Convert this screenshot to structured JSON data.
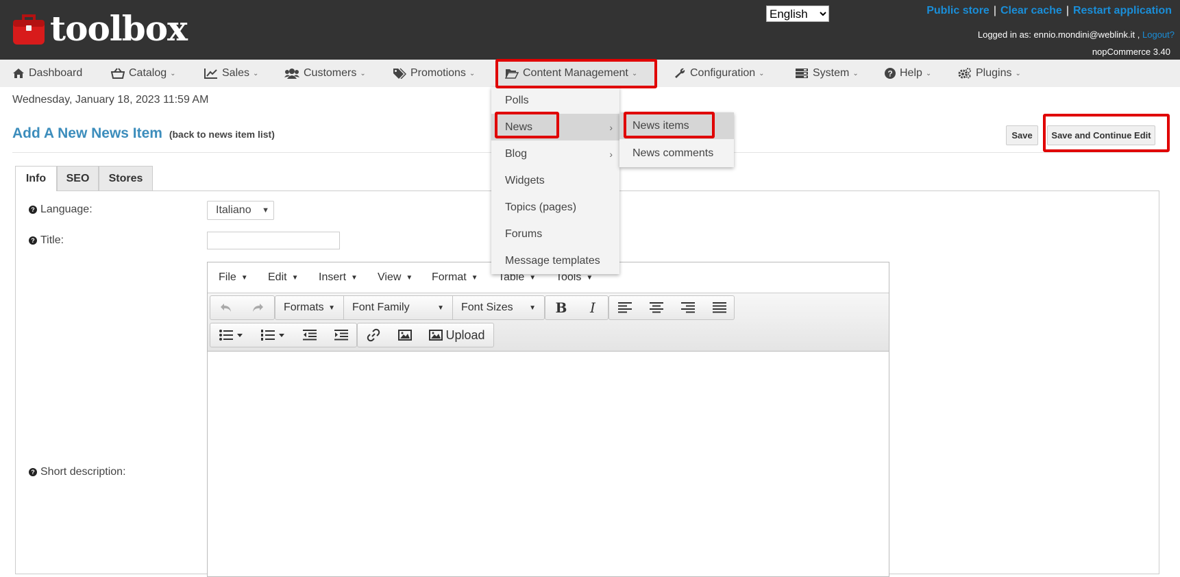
{
  "header": {
    "logo_text": "toolbox",
    "language_selected": "English",
    "links": [
      "Public store",
      "Clear cache",
      "Restart application"
    ],
    "logged_in_prefix": "Logged in as: ennio.mondini@weblink.it ,",
    "logout_label": "Logout?",
    "version": "nopCommerce 3.40"
  },
  "menu": {
    "dashboard": "Dashboard",
    "catalog": "Catalog",
    "sales": "Sales",
    "customers": "Customers",
    "promotions": "Promotions",
    "content_management": "Content Management",
    "configuration": "Configuration",
    "system": "System",
    "help": "Help",
    "plugins": "Plugins"
  },
  "dropdown": {
    "items": [
      "Polls",
      "News",
      "Blog",
      "Widgets",
      "Topics (pages)",
      "Forums",
      "Message templates"
    ],
    "news_submenu": [
      "News items",
      "News comments"
    ]
  },
  "page": {
    "date": "Wednesday, January 18, 2023 11:59 AM",
    "title": "Add A New News Item",
    "back_link": "(back to news item list)",
    "save_label": "Save",
    "save_continue_label": "Save and Continue Edit"
  },
  "tabs": [
    "Info",
    "SEO",
    "Stores"
  ],
  "form": {
    "language_label": "Language:",
    "language_value": "Italiano",
    "title_label": "Title:",
    "title_value": "",
    "short_description_label": "Short description:"
  },
  "editor": {
    "menus": [
      "File",
      "Edit",
      "Insert",
      "View",
      "Format",
      "Table",
      "Tools"
    ],
    "formats_label": "Formats",
    "font_family_label": "Font Family",
    "font_sizes_label": "Font Sizes",
    "upload_label": "Upload"
  },
  "colors": {
    "header_bg": "#333333",
    "link_blue": "#1a8ed8",
    "title_blue": "#3c8dbc",
    "highlight_red": "#e00000"
  }
}
